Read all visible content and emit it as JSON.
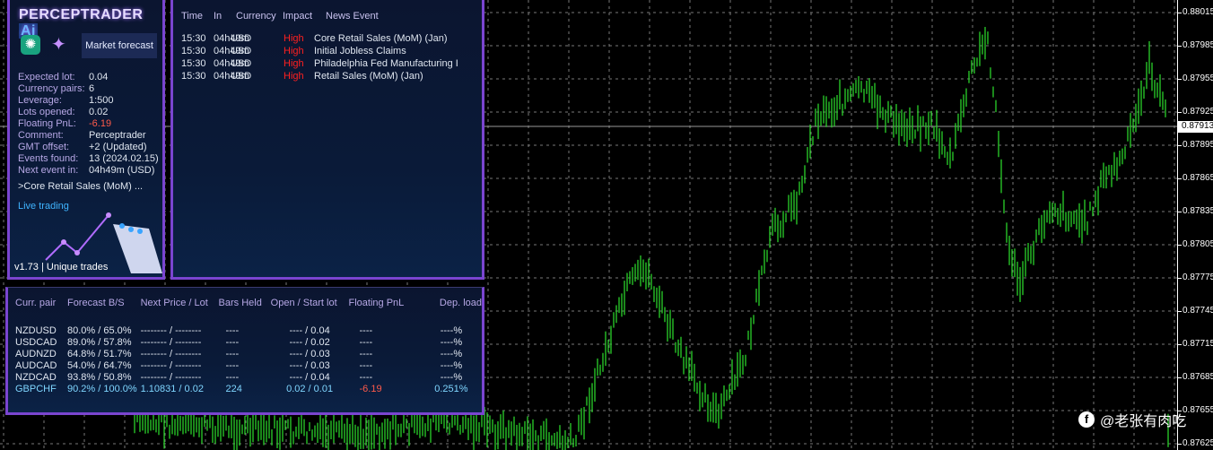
{
  "info": {
    "logo": "PERCEPTRADER",
    "logo_ai": "Ai",
    "market_forecast": "Market forecast",
    "rows": [
      [
        "Expected lot:",
        "0.04"
      ],
      [
        "Currency pairs:",
        "6"
      ],
      [
        "Leverage:",
        "1:500"
      ],
      [
        "Lots opened:",
        "0.02"
      ],
      [
        "Floating PnL:",
        "-6.19"
      ],
      [
        "Comment:",
        "Perceptrader"
      ],
      [
        "GMT offset:",
        "+2 (Updated)"
      ],
      [
        "Events found:",
        "13 (2024.02.15)"
      ],
      [
        "Next event in:",
        "04h49m (USD)"
      ]
    ],
    "next_event": ">Core Retail Sales (MoM) ...",
    "live": "Live trading",
    "version": "v1.73 | Unique trades"
  },
  "news": {
    "headers": [
      "Time",
      "In",
      "Currency",
      "Impact",
      "News Event"
    ],
    "rows": [
      [
        "15:30",
        "04h49m",
        "USD",
        "High",
        "Core Retail Sales (MoM) (Jan)"
      ],
      [
        "15:30",
        "04h49m",
        "USD",
        "High",
        "Initial Jobless Claims"
      ],
      [
        "15:30",
        "04h49m",
        "USD",
        "High",
        "Philadelphia Fed Manufacturing I"
      ],
      [
        "15:30",
        "04h49m",
        "USD",
        "High",
        "Retail Sales (MoM) (Jan)"
      ]
    ]
  },
  "pairs": {
    "headers": [
      "Curr. pair",
      "Forecast B/S",
      "Next Price / Lot",
      "Bars Held",
      "Open / Start lot",
      "Floating PnL",
      "Dep. load"
    ],
    "rows": [
      [
        "NZDUSD",
        "80.0% / 65.0%",
        "-------- / --------",
        "----",
        "---- / 0.04",
        "----",
        "----%"
      ],
      [
        "USDCAD",
        "89.0% / 57.8%",
        "-------- / --------",
        "----",
        "---- / 0.02",
        "----",
        "----%"
      ],
      [
        "AUDNZD",
        "64.8% / 51.7%",
        "-------- / --------",
        "----",
        "---- / 0.03",
        "----",
        "----%"
      ],
      [
        "AUDCAD",
        "54.0% / 64.7%",
        "-------- / --------",
        "----",
        "---- / 0.03",
        "----",
        "----%"
      ],
      [
        "NZDCAD",
        "93.8% / 50.8%",
        "-------- / --------",
        "----",
        "---- / 0.04",
        "----",
        "----%"
      ],
      [
        "GBPCHF",
        "90.2% / 100.0%",
        "1.10831 / 0.02",
        "224",
        "0.02 / 0.01",
        "-6.19",
        "0.251%"
      ]
    ]
  },
  "price_axis": {
    "ticks": [
      "0.88015",
      "0.87985",
      "0.87955",
      "0.87925",
      "0.87895",
      "0.87865",
      "0.87835",
      "0.87805",
      "0.87775",
      "0.87745",
      "0.87715",
      "0.87685",
      "0.87655",
      "0.87625"
    ],
    "current": "0.87913"
  },
  "watermark": "@老张有肉吃",
  "colors": {
    "bars": "#2ad22a",
    "border": "#7a45d0",
    "negative": "#ff5a4a",
    "impact_high": "#ff2020",
    "active_pair": "#7fd6ff"
  }
}
